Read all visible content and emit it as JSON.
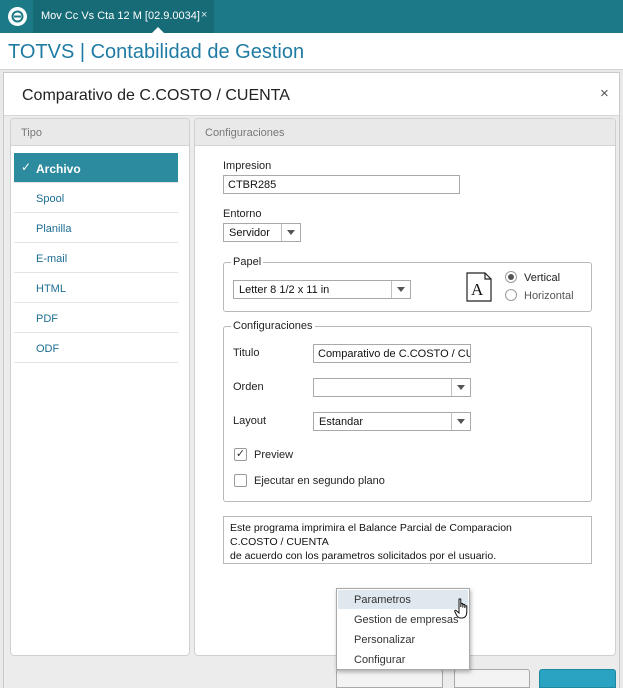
{
  "tab": {
    "label": "Mov Cc Vs Cta 12 M [02.9.0034]",
    "close": "×"
  },
  "app": {
    "title": "TOTVS | Contabilidad de Gestion"
  },
  "dialog": {
    "title": "Comparativo de C.COSTO /  CUENTA",
    "close": "×"
  },
  "tipo": {
    "header": "Tipo",
    "items": [
      "Archivo",
      "Spool",
      "Planilla",
      "E-mail",
      "HTML",
      "PDF",
      "ODF"
    ],
    "selected_index": 0,
    "check": "✓"
  },
  "config": {
    "header": "Configuraciones",
    "impresion_label": "Impresion",
    "impresion_value": "CTBR285",
    "entorno_label": "Entorno",
    "entorno_value": "Servidor",
    "papel": {
      "legend": "Papel",
      "size": "Letter 8 1/2 x 11 in",
      "orientation_icon": "page-a-icon",
      "orientation_glyph": "A",
      "vertical": "Vertical",
      "horizontal": "Horizontal",
      "selected": "Vertical"
    },
    "settings": {
      "legend": "Configuraciones",
      "titulo_label": "Titulo",
      "titulo_value": "Comparativo de C.COSTO /  CUENTA",
      "orden_label": "Orden",
      "orden_value": "",
      "layout_label": "Layout",
      "layout_value": "Estandar",
      "preview_label": "Preview",
      "preview_checked": true,
      "background_label": "Ejecutar en segundo plano",
      "background_checked": false
    },
    "description": [
      "Este programa imprimira el Balance Parcial de Comparacion",
      "C.COSTO /  CUENTA",
      "de acuerdo con los parametros solicitados por el usuario."
    ]
  },
  "menu": {
    "items": [
      "Parametros",
      "Gestion de empresas",
      "Personalizar",
      "Configurar"
    ],
    "hover_index": 0
  },
  "colors": {
    "topbar": "#1b7a86",
    "title": "#1f7ba3",
    "selected": "#2c8b9e",
    "primary": "#2aa2c1"
  }
}
